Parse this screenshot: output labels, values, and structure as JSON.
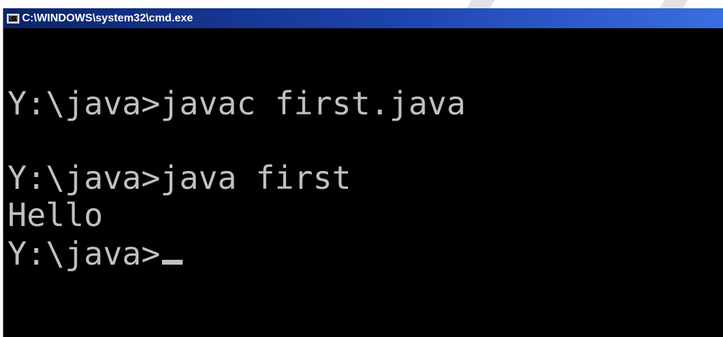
{
  "window": {
    "title": "C:\\WINDOWS\\system32\\cmd.exe",
    "icon": "cmd-icon",
    "icon_text": "C:\\"
  },
  "console": {
    "lines": [
      "Y:\\java>javac first.java",
      "Y:\\java>java first",
      "Hello",
      "Y:\\java>"
    ]
  },
  "colors": {
    "console_background": "#000000",
    "console_text": "#c0c0c0",
    "titlebar_start": "#0a246a",
    "titlebar_end": "#3a6ee0"
  }
}
